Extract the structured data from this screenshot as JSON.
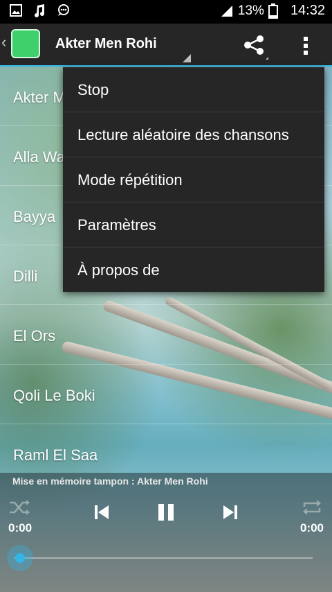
{
  "status_bar": {
    "notification_icons": [
      "image-icon",
      "music-note-icon",
      "chat-icon"
    ],
    "signal_icon": "signal-icon",
    "battery_percent": "13%",
    "time": "14:32"
  },
  "action_bar": {
    "title": "Akter Men Rohi",
    "share_icon": "share-icon",
    "overflow_icon": "more-vertical-icon",
    "accent_color": "#33b5e5"
  },
  "songs": [
    "Akter M",
    "Alla Wa",
    "Bayya",
    "Dilli",
    "El Ors",
    "Qoli Le Boki",
    "Raml El Saa"
  ],
  "player": {
    "caching_text": "Mise en mémoire tampon : Akter Men Rohi",
    "time_elapsed": "0:00",
    "time_total": "0:00",
    "progress": 0
  },
  "menu": {
    "items": [
      "Stop",
      "Lecture aléatoire des chansons",
      "Mode répétition",
      "Paramètres",
      "À propos de"
    ]
  }
}
